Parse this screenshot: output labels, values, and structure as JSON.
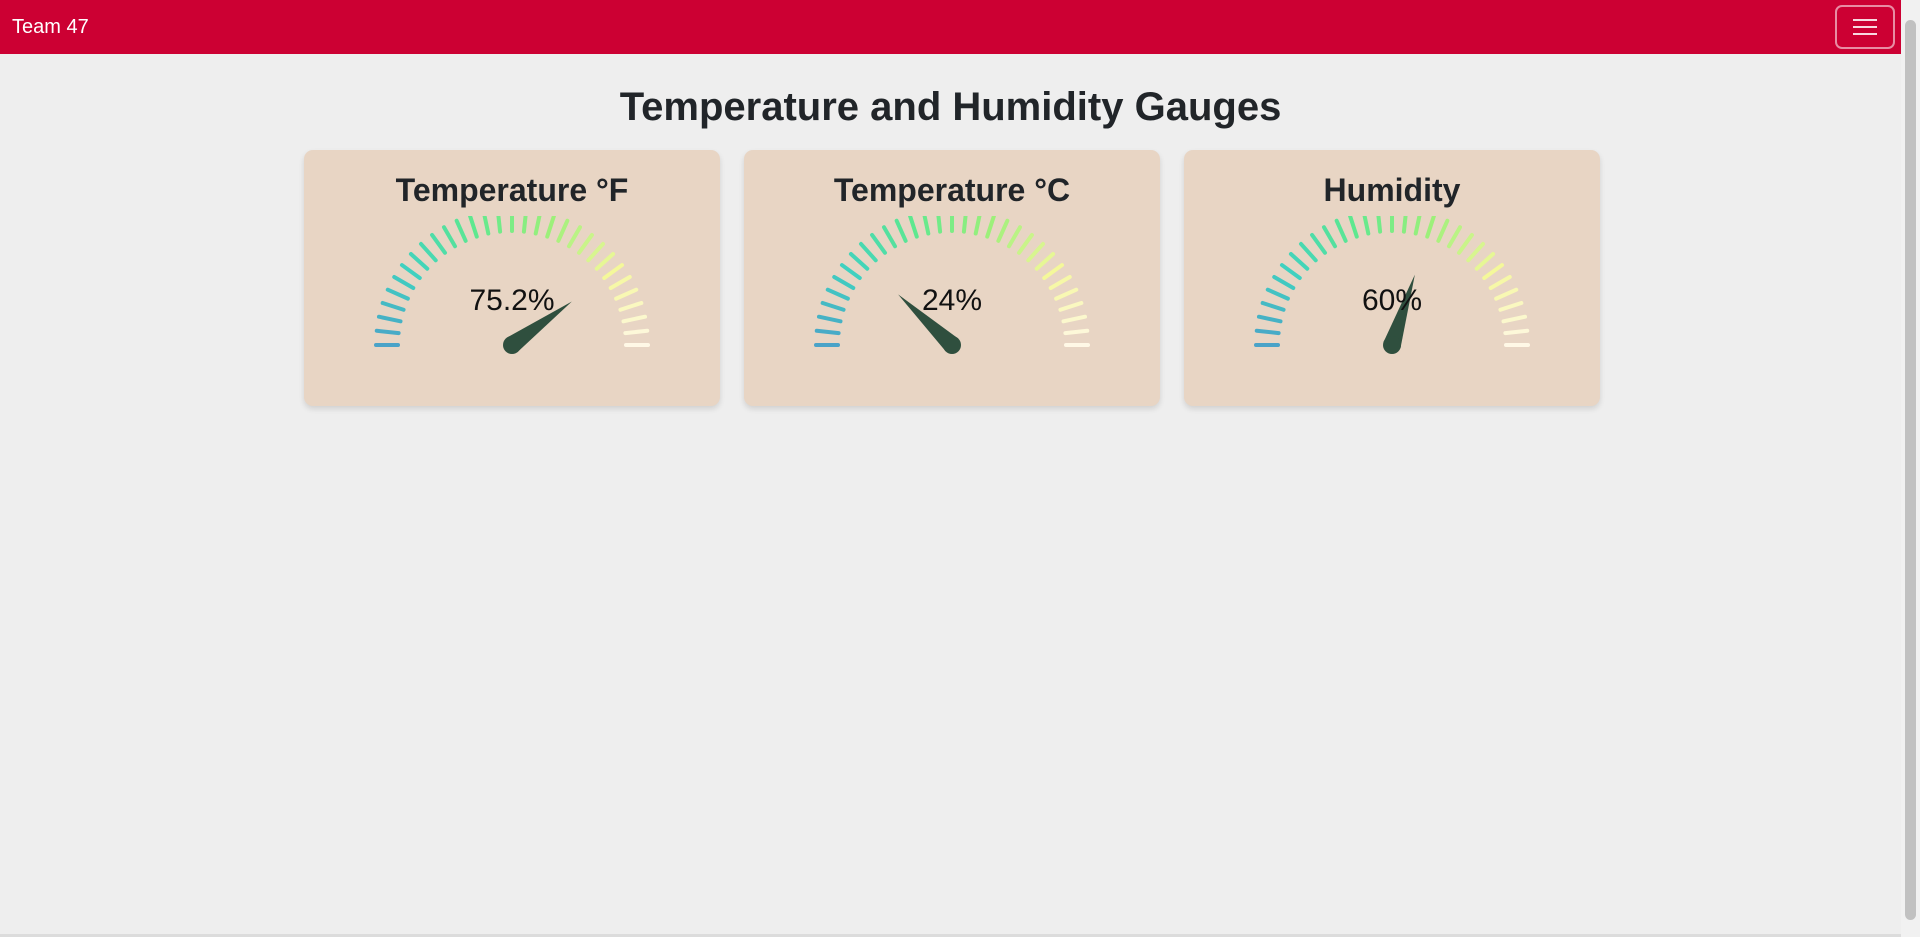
{
  "colors": {
    "brand": "#cc0033",
    "needle": "#2f4f3e",
    "gauge_gradient": [
      "#4aa3c8",
      "#3fd1c0",
      "#5ee88f",
      "#9df07a",
      "#f4f89a",
      "#fff8e6"
    ]
  },
  "navbar": {
    "brand": "Team 47",
    "menu_icon": "hamburger-icon"
  },
  "page": {
    "title": "Temperature and Humidity Gauges"
  },
  "gauges": [
    {
      "title": "Temperature °F",
      "value_text": "75.2%",
      "needle_fraction": 0.8
    },
    {
      "title": "Temperature °C",
      "value_text": "24%",
      "needle_fraction": 0.24
    },
    {
      "title": "Humidity",
      "value_text": "60%",
      "needle_fraction": 0.6
    }
  ]
}
